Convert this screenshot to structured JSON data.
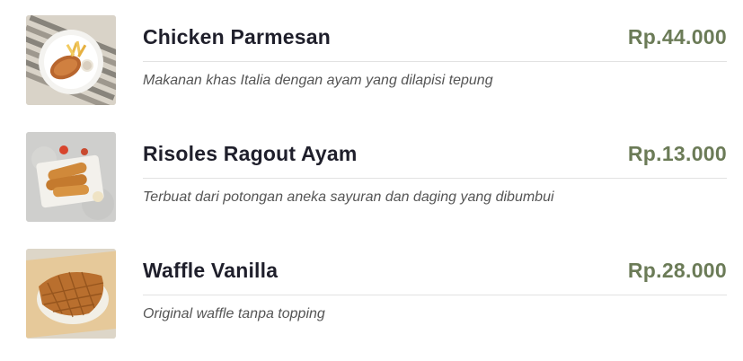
{
  "colors": {
    "name": "#1f1f2b",
    "price": "#6b7b57",
    "description": "#555555",
    "divider": "#e2e2e2"
  },
  "menu": {
    "items": [
      {
        "name": "Chicken Parmesan",
        "price": "Rp.44.000",
        "description": "Makanan khas Italia dengan ayam yang dilapisi tepung",
        "image_icon": "chicken-parmesan-photo"
      },
      {
        "name": "Risoles Ragout Ayam",
        "price": "Rp.13.000",
        "description": "Terbuat dari potongan aneka sayuran dan daging yang dibumbui",
        "image_icon": "risoles-photo"
      },
      {
        "name": "Waffle Vanilla",
        "price": "Rp.28.000",
        "description": "Original waffle tanpa topping",
        "image_icon": "waffle-photo"
      }
    ]
  }
}
